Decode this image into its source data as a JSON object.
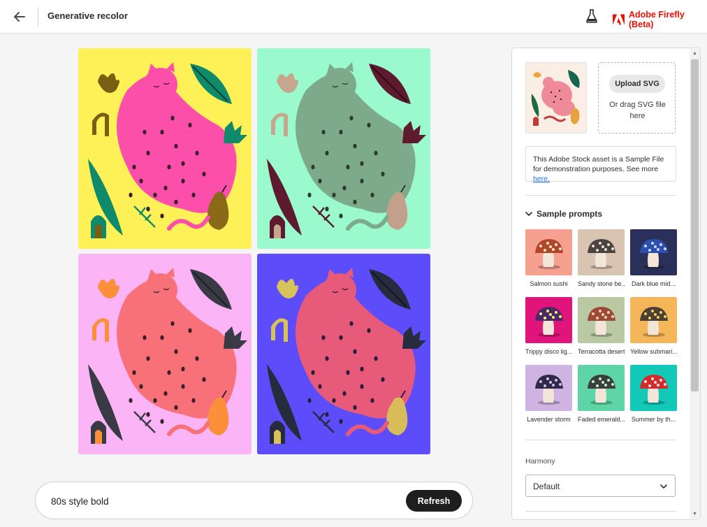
{
  "header": {
    "title": "Generative recolor",
    "brand": "Adobe Firefly (Beta)",
    "icons": {
      "back": "arrow-left-icon",
      "labs": "flask-icon",
      "brand_logo": "adobe-logo-icon"
    }
  },
  "variations": [
    {
      "bg": "#fdf157",
      "body": "#fb4fa9",
      "leaf": "#0f8a6a",
      "leaf_vein": "#0b3d33",
      "accent": "#7a5f12",
      "pear": "#8a6a18",
      "grass": "#0f8a6a",
      "spots": "#3a1f2a"
    },
    {
      "bg": "#9af9cd",
      "body": "#7daa8a",
      "leaf": "#5e1a2e",
      "leaf_vein": "#2b0a14",
      "accent": "#c7a68e",
      "pear": "#c3a08c",
      "grass": "#5e1a2e",
      "spots": "#2c3a30"
    },
    {
      "bg": "#fbb5f6",
      "body": "#f87178",
      "leaf": "#3a3a46",
      "leaf_vein": "#1d1d24",
      "accent": "#fb8f3a",
      "pear": "#fb8f3a",
      "grass": "#3a3a46",
      "spots": "#3a1f2a"
    },
    {
      "bg": "#5d4cf9",
      "body": "#e85a7a",
      "leaf": "#262c3e",
      "leaf_vein": "#111522",
      "accent": "#d8c25a",
      "pear": "#d8bc5a",
      "grass": "#262c3e",
      "spots": "#2a1d3a"
    }
  ],
  "prompt": {
    "value": "80s style bold",
    "refresh_label": "Refresh"
  },
  "panel": {
    "upload_label": "Upload SVG",
    "upload_hint": "Or drag SVG file here",
    "notice_text": "This Adobe Stock asset is a Sample File for demonstration purposes. See more ",
    "notice_link": "here.",
    "sample_prompts_title": "Sample prompts",
    "sample_prompts": [
      {
        "label": "Salmon sushi",
        "bg": "#f6a090",
        "cap": "#b0472a",
        "dots": "#f7e6c8"
      },
      {
        "label": "Sandy stone be...",
        "bg": "#d9c4b2",
        "cap": "#4a4340",
        "dots": "#e9e2d8"
      },
      {
        "label": "Dark blue mid...",
        "bg": "#2a3059",
        "cap": "#2c4fb0",
        "dots": "#cfd8f5"
      },
      {
        "label": "Trippy disco lig...",
        "bg": "#e0147a",
        "cap": "#4a2a66",
        "dots": "#f7f07a"
      },
      {
        "label": "Terracotta desert",
        "bg": "#b8c9a4",
        "cap": "#9c4a36",
        "dots": "#f1d3b8"
      },
      {
        "label": "Yellow submari...",
        "bg": "#f5b65a",
        "cap": "#4a4038",
        "dots": "#f5d64a"
      },
      {
        "label": "Lavender storm",
        "bg": "#cfb3e2",
        "cap": "#2f2a4a",
        "dots": "#d8c0f0"
      },
      {
        "label": "Faded emerald...",
        "bg": "#5fd4a6",
        "cap": "#3a3f3c",
        "dots": "#c4efd8"
      },
      {
        "label": "Summer by th...",
        "bg": "#12c9b8",
        "cap": "#d22b2b",
        "dots": "#fbe3e3"
      }
    ],
    "harmony_label": "Harmony",
    "harmony_value": "Default"
  }
}
